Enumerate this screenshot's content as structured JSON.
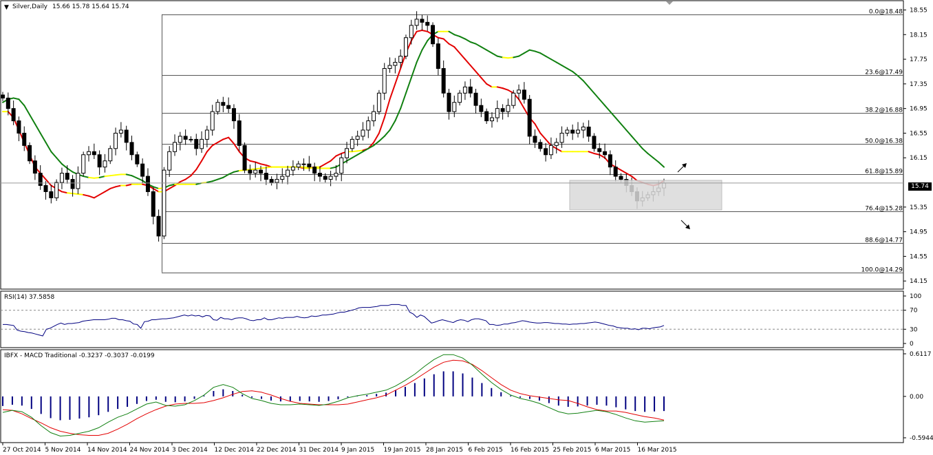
{
  "header": {
    "symbol": "Silver,Daily",
    "ohlc": "15.66 15.78 15.64 15.74"
  },
  "price_tag": "15.74",
  "rsi_label": "RSI(14) 37.5858",
  "macd_label": "IBFX - MACD Traditional -0.3237 -0.3037 -0.0199",
  "colors": {
    "ma_fast": "#e30000",
    "ma_slow": "#108010",
    "ma_flat": "#ffff00",
    "rsi": "#000080",
    "macd_signal": "#e30000",
    "macd_line": "#108010",
    "histogram": "#000080",
    "zone": "#d9d9d9"
  },
  "chart_data": [
    {
      "type": "candlestick",
      "title": "Silver,Daily",
      "ylim": [
        14.13,
        18.6
      ],
      "y_ticks": [
        "18.55",
        "18.15",
        "17.75",
        "17.35",
        "16.95",
        "16.55",
        "16.15",
        "15.74",
        "15.35",
        "14.95",
        "14.55",
        "14.15"
      ],
      "x_ticks": [
        "27 Oct 2014",
        "5 Nov 2014",
        "14 Nov 2014",
        "24 Nov 2014",
        "3 Dec 2014",
        "12 Dec 2014",
        "22 Dec 2014",
        "31 Dec 2014",
        "9 Jan 2015",
        "19 Jan 2015",
        "28 Jan 2015",
        "6 Feb 2015",
        "16 Feb 2015",
        "25 Feb 2015",
        "6 Mar 2015",
        "16 Mar 2015"
      ],
      "fib_levels": [
        {
          "label": "0.0@18.48",
          "value": 18.48
        },
        {
          "label": "23.6@17.49",
          "value": 17.49
        },
        {
          "label": "38.2@16.88",
          "value": 16.88
        },
        {
          "label": "50.0@16.38",
          "value": 16.38
        },
        {
          "label": "61.8@15.89",
          "value": 15.89
        },
        {
          "label": "76.4@15.28",
          "value": 15.28
        },
        {
          "label": "88.6@14.77",
          "value": 14.77
        },
        {
          "label": "100.0@14.29",
          "value": 14.29
        }
      ],
      "zone": {
        "low": 15.38,
        "high": 15.88
      },
      "close_series": [
        17.12,
        16.95,
        16.75,
        16.55,
        16.35,
        16.1,
        15.9,
        15.7,
        15.6,
        15.5,
        15.75,
        15.9,
        15.8,
        15.65,
        15.9,
        16.2,
        16.25,
        16.2,
        16.0,
        16.1,
        16.3,
        16.55,
        16.6,
        16.4,
        16.2,
        16.05,
        15.85,
        15.6,
        15.2,
        14.88,
        15.95,
        16.25,
        16.4,
        16.5,
        16.45,
        16.45,
        16.3,
        16.45,
        16.6,
        16.9,
        17.05,
        17.0,
        16.95,
        16.75,
        16.35,
        15.95,
        15.9,
        15.95,
        15.9,
        15.8,
        15.75,
        15.8,
        15.85,
        15.95,
        16.0,
        16.05,
        16.05,
        16.0,
        15.9,
        15.85,
        15.8,
        15.85,
        15.9,
        16.15,
        16.3,
        16.45,
        16.5,
        16.6,
        16.75,
        16.9,
        17.2,
        17.6,
        17.65,
        17.7,
        17.8,
        18.1,
        18.3,
        18.4,
        18.35,
        18.3,
        18.0,
        17.6,
        17.2,
        16.9,
        17.05,
        17.2,
        17.3,
        17.2,
        17.0,
        16.9,
        16.75,
        16.8,
        16.95,
        16.9,
        17.0,
        17.2,
        17.25,
        17.1,
        16.5,
        16.4,
        16.3,
        16.2,
        16.35,
        16.4,
        16.55,
        16.6,
        16.55,
        16.6,
        16.65,
        16.5,
        16.3,
        16.25,
        16.2,
        16.0,
        15.85,
        15.8,
        15.7,
        15.6,
        15.45,
        15.5,
        15.55,
        15.6,
        15.66,
        15.74
      ],
      "series": [
        {
          "name": "MA fast",
          "values": [
            16.9,
            16.9,
            16.8,
            16.6,
            16.4,
            16.2,
            16.0,
            15.9,
            15.8,
            15.7,
            15.65,
            15.6,
            15.58,
            15.57,
            15.56,
            15.55,
            15.53,
            15.5,
            15.55,
            15.6,
            15.65,
            15.68,
            15.7,
            15.7,
            15.72,
            15.72,
            15.72,
            15.7,
            15.65,
            15.6,
            15.6,
            15.65,
            15.7,
            15.76,
            15.8,
            15.86,
            15.96,
            16.1,
            16.25,
            16.35,
            16.4,
            16.45,
            16.48,
            16.38,
            16.25,
            16.15,
            16.1,
            16.08,
            16.05,
            16.03,
            16.0,
            16.0,
            16.0,
            16.0,
            16.0,
            16.0,
            15.98,
            15.98,
            16.0,
            16.0,
            16.05,
            16.1,
            16.18,
            16.22,
            16.25,
            16.25,
            16.26,
            16.27,
            16.3,
            16.4,
            16.55,
            16.8,
            17.1,
            17.35,
            17.6,
            17.85,
            18.05,
            18.2,
            18.22,
            18.2,
            18.15,
            18.1,
            18.08,
            18.0,
            17.95,
            17.85,
            17.75,
            17.65,
            17.55,
            17.45,
            17.35,
            17.3,
            17.3,
            17.28,
            17.25,
            17.2,
            17.1,
            16.95,
            16.8,
            16.7,
            16.55,
            16.45,
            16.35,
            16.3,
            16.25,
            16.25,
            16.25,
            16.25,
            16.25,
            16.25,
            16.22,
            16.2,
            16.15,
            16.05,
            16.0,
            15.95,
            15.9,
            15.85,
            15.78,
            15.75,
            15.72,
            15.7,
            15.72,
            15.78
          ]
        },
        {
          "name": "MA slow",
          "values": [
            17.05,
            17.1,
            17.12,
            17.1,
            17.0,
            16.85,
            16.7,
            16.55,
            16.4,
            16.25,
            16.15,
            16.05,
            15.98,
            15.92,
            15.88,
            15.85,
            15.83,
            15.82,
            15.83,
            15.85,
            15.86,
            15.87,
            15.88,
            15.88,
            15.86,
            15.82,
            15.78,
            15.72,
            15.68,
            15.65,
            15.66,
            15.7,
            15.72,
            15.72,
            15.72,
            15.72,
            15.72,
            15.74,
            15.75,
            15.77,
            15.8,
            15.83,
            15.88,
            15.92,
            15.94,
            15.95,
            15.96,
            15.97,
            15.98,
            15.99,
            16.0,
            16.0,
            16.0,
            16.0,
            16.0,
            16.0,
            16.0,
            15.99,
            15.98,
            15.98,
            15.98,
            15.98,
            16.0,
            16.05,
            16.1,
            16.15,
            16.2,
            16.25,
            16.3,
            16.35,
            16.42,
            16.5,
            16.6,
            16.75,
            16.95,
            17.2,
            17.45,
            17.7,
            17.9,
            18.05,
            18.15,
            18.2,
            18.2,
            18.2,
            18.15,
            18.12,
            18.08,
            18.03,
            18.0,
            17.95,
            17.9,
            17.85,
            17.8,
            17.78,
            17.77,
            17.78,
            17.8,
            17.85,
            17.9,
            17.88,
            17.85,
            17.8,
            17.75,
            17.7,
            17.65,
            17.6,
            17.55,
            17.48,
            17.4,
            17.3,
            17.2,
            17.1,
            17.0,
            16.9,
            16.8,
            16.7,
            16.6,
            16.5,
            16.4,
            16.3,
            16.22,
            16.15,
            16.08,
            16.0
          ]
        }
      ]
    },
    {
      "type": "line",
      "title": "RSI(14) 37.5858",
      "ylim": [
        0,
        100
      ],
      "y_ticks": [
        "100",
        "70",
        "30",
        "0"
      ],
      "levels": [
        70,
        30
      ],
      "series": [
        {
          "name": "RSI(14)",
          "values": [
            40,
            40,
            39,
            38,
            28,
            26,
            25,
            23,
            22,
            20,
            18,
            16,
            30,
            32,
            36,
            40,
            43,
            40,
            42,
            42,
            43,
            44,
            47,
            48,
            49,
            50,
            50,
            50,
            50,
            51,
            53,
            53,
            50,
            50,
            48,
            47,
            41,
            40,
            32,
            46,
            47,
            50,
            50,
            51,
            52,
            52,
            53,
            54,
            56,
            58,
            60,
            58,
            60,
            58,
            59,
            56,
            59,
            58,
            50,
            49,
            55,
            52,
            52,
            50,
            53,
            54,
            54,
            52,
            49,
            48,
            50,
            50,
            54,
            50,
            50,
            52,
            54,
            53,
            55,
            55,
            55,
            57,
            55,
            54,
            55,
            58,
            57,
            58,
            60,
            60,
            61,
            62,
            64,
            66,
            66,
            68,
            70,
            72,
            75,
            76,
            76,
            76,
            77,
            78,
            80,
            80,
            80,
            82,
            82,
            82,
            80,
            80,
            66,
            62,
            55,
            60,
            57,
            50,
            43,
            45,
            48,
            50,
            48,
            46,
            44,
            48,
            50,
            49,
            46,
            50,
            52,
            52,
            50,
            48,
            40,
            40,
            38,
            39,
            41,
            41,
            43,
            44,
            46,
            48,
            47,
            45,
            44,
            43,
            43,
            44,
            44,
            43,
            42,
            42,
            41,
            41,
            40,
            41,
            41,
            42,
            42,
            43,
            44,
            45,
            44,
            42,
            40,
            38,
            37,
            34,
            33,
            32,
            32,
            30,
            31,
            29,
            32,
            32,
            31,
            33,
            34,
            35,
            38
          ]
        }
      ]
    },
    {
      "type": "line",
      "title": "IBFX - MACD Traditional -0.3237 -0.3037 -0.0199",
      "ylim": [
        -0.5944,
        0.6117
      ],
      "y_ticks": [
        "0.6117",
        "0.00",
        "-0.5944"
      ],
      "series": [
        {
          "name": "MACD signal",
          "values": [
            -0.19,
            -0.2,
            -0.25,
            -0.32,
            -0.38,
            -0.45,
            -0.5,
            -0.53,
            -0.55,
            -0.56,
            -0.56,
            -0.53,
            -0.47,
            -0.4,
            -0.32,
            -0.25,
            -0.19,
            -0.14,
            -0.11,
            -0.1,
            -0.1,
            -0.09,
            -0.06,
            -0.02,
            0.03,
            0.07,
            0.08,
            0.06,
            0.02,
            -0.03,
            -0.07,
            -0.1,
            -0.11,
            -0.12,
            -0.12,
            -0.12,
            -0.11,
            -0.08,
            -0.05,
            -0.02,
            0.02,
            0.09,
            0.16,
            0.24,
            0.33,
            0.42,
            0.49,
            0.52,
            0.51,
            0.46,
            0.37,
            0.27,
            0.17,
            0.09,
            0.04,
            0.01,
            -0.01,
            -0.03,
            -0.05,
            -0.06,
            -0.1,
            -0.15,
            -0.19,
            -0.21,
            -0.21,
            -0.23,
            -0.26,
            -0.29,
            -0.31,
            -0.34
          ]
        },
        {
          "name": "MACD line",
          "values": [
            -0.23,
            -0.2,
            -0.22,
            -0.3,
            -0.42,
            -0.52,
            -0.57,
            -0.56,
            -0.53,
            -0.5,
            -0.45,
            -0.37,
            -0.3,
            -0.25,
            -0.18,
            -0.11,
            -0.08,
            -0.13,
            -0.14,
            -0.12,
            -0.06,
            0.02,
            0.13,
            0.17,
            0.13,
            0.04,
            -0.03,
            -0.06,
            -0.1,
            -0.12,
            -0.12,
            -0.11,
            -0.12,
            -0.13,
            -0.11,
            -0.07,
            -0.02,
            0.01,
            0.03,
            0.06,
            0.09,
            0.15,
            0.23,
            0.32,
            0.43,
            0.53,
            0.6,
            0.6,
            0.55,
            0.45,
            0.32,
            0.2,
            0.1,
            0.02,
            -0.03,
            -0.06,
            -0.1,
            -0.16,
            -0.22,
            -0.25,
            -0.24,
            -0.22,
            -0.2,
            -0.22,
            -0.26,
            -0.31,
            -0.35,
            -0.37,
            -0.36,
            -0.35
          ]
        }
      ]
    }
  ]
}
